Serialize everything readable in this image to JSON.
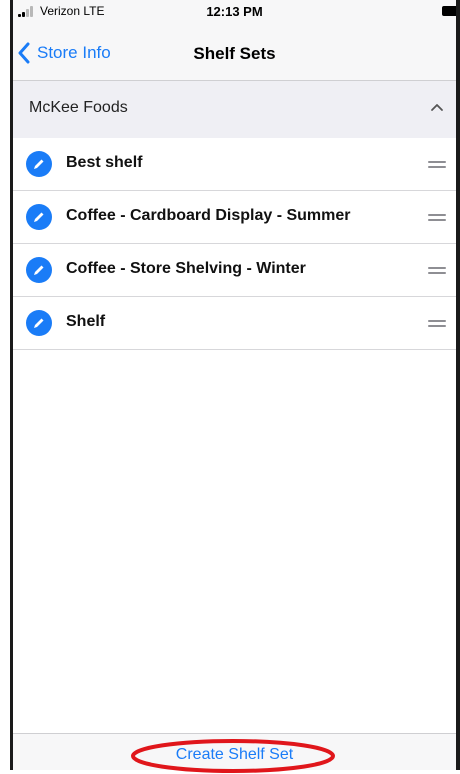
{
  "status_bar": {
    "carrier": "Verizon  LTE",
    "time": "12:13 PM"
  },
  "nav": {
    "back_label": "Store Info",
    "title": "Shelf Sets"
  },
  "section": {
    "title": "McKee Foods"
  },
  "shelf_sets": [
    {
      "label": "Best shelf"
    },
    {
      "label": "Coffee - Cardboard Display - Summer"
    },
    {
      "label": "Coffee - Store Shelving - Winter"
    },
    {
      "label": "Shelf"
    }
  ],
  "toolbar": {
    "create_label": "Create Shelf Set"
  },
  "colors": {
    "accent": "#1a7cf7",
    "annotation": "#e0161b"
  },
  "icons": {
    "back": "chevron-left-icon",
    "collapse": "chevron-up-icon",
    "edit": "pencil-icon",
    "reorder": "drag-handle-icon"
  }
}
